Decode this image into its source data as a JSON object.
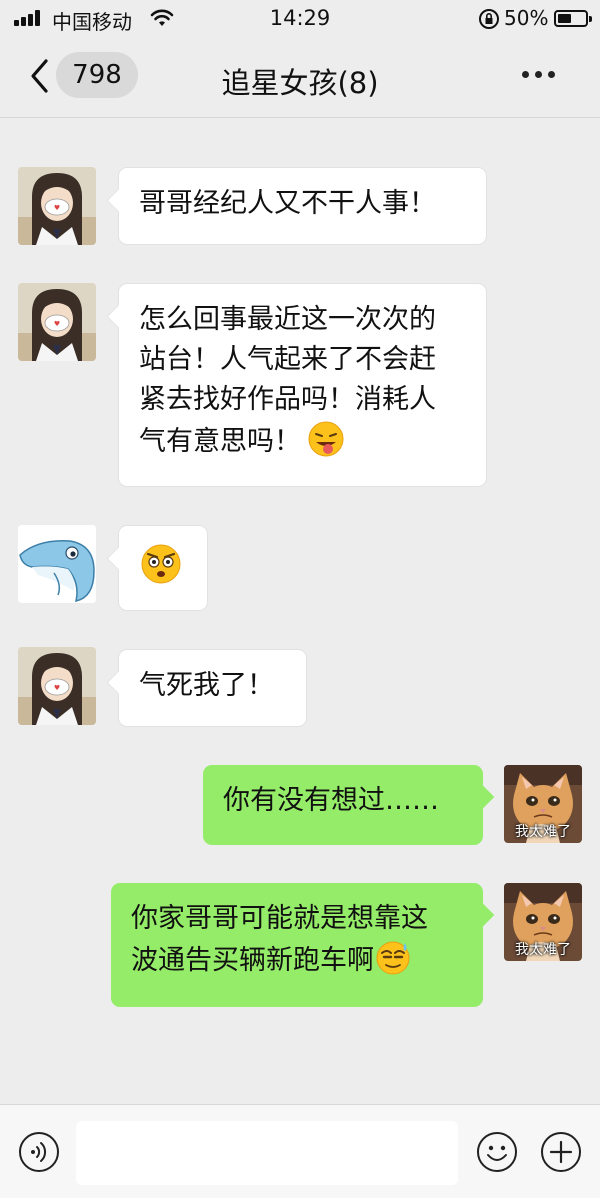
{
  "status_bar": {
    "carrier": "中国移动",
    "time": "14:29",
    "battery_percent": "50%",
    "battery_level": 0.5
  },
  "nav": {
    "unread_count": "798",
    "title": "追星女孩(8)"
  },
  "messages": [
    {
      "side": "left",
      "avatar": "girl-mask-avatar",
      "text": "哥哥经纪人又不干人事！"
    },
    {
      "side": "left",
      "avatar": "girl-mask-avatar",
      "lines": [
        "怎么回事最近这一次次的",
        "站台！人气起来了不会赶",
        "紧去找好作品吗！消耗人",
        "气有意思吗！"
      ],
      "emoji": "tongue-out-emoji"
    },
    {
      "side": "left",
      "avatar": "dolphin-avatar",
      "emoji": "shocked-face-emoji"
    },
    {
      "side": "left",
      "avatar": "girl-mask-avatar",
      "text": "气死我了！"
    },
    {
      "side": "right",
      "avatar": "cat-avatar",
      "avatar_caption": "我太难了",
      "text": "你有没有想过……"
    },
    {
      "side": "right",
      "avatar": "cat-avatar",
      "avatar_caption": "我太难了",
      "lines": [
        "你家哥哥可能就是想靠这",
        "波通告买辆新跑车啊"
      ],
      "emoji": "sweat-face-emoji"
    }
  ],
  "input_bar": {
    "placeholder": "",
    "icons": [
      "voice-icon",
      "emoji-icon",
      "plus-icon"
    ]
  },
  "colors": {
    "background": "#ededed",
    "outgoing_bubble": "#95ec69",
    "incoming_bubble": "#ffffff"
  }
}
